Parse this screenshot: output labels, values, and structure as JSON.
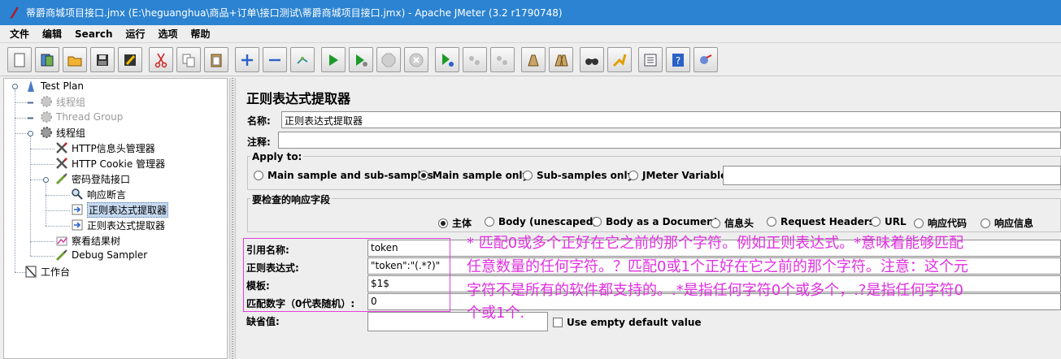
{
  "window": {
    "title": "蒂爵商城项目接口.jmx (E:\\heguanghua\\商品+订单\\接口测试\\蒂爵商城项目接口.jmx) - Apache JMeter (3.2 r1790748)"
  },
  "menu": [
    "文件",
    "编辑",
    "Search",
    "运行",
    "选项",
    "帮助"
  ],
  "toolbar": {
    "buttons": [
      "new-icon",
      "templates-icon",
      "open-icon",
      "save-icon",
      "save-as-icon",
      "cut-icon",
      "copy-icon",
      "paste-icon",
      "expand-icon",
      "collapse-icon",
      "toggle-icon",
      "start-icon",
      "start-no-pause-icon",
      "stop-icon",
      "shutdown-icon",
      "remote-start-icon",
      "remote-stop-icon",
      "remote-shutdown-icon",
      "clear-icon",
      "clear-all-icon",
      "search-icon",
      "reset-search-icon",
      "function-helper-icon",
      "help-icon",
      "log-viewer-icon"
    ]
  },
  "tree": {
    "nodes": [
      {
        "label": "Test Plan",
        "icon": "test-plan-icon"
      },
      {
        "label": "线程组",
        "icon": "gear-icon",
        "disabled": true
      },
      {
        "label": "Thread Group",
        "icon": "gear-icon",
        "disabled": true
      },
      {
        "label": "线程组",
        "icon": "gear-icon"
      },
      {
        "label": "HTTP信息头管理器",
        "icon": "tools-icon"
      },
      {
        "label": "HTTP Cookie 管理器",
        "icon": "tools-icon"
      },
      {
        "label": "密码登陆接口",
        "icon": "pipette-icon"
      },
      {
        "label": "响应断言",
        "icon": "magnifier-icon"
      },
      {
        "label": "正则表达式提取器",
        "icon": "extractor-icon",
        "selected": true
      },
      {
        "label": "正则表达式提取器",
        "icon": "extractor-icon"
      },
      {
        "label": "察看结果树",
        "icon": "chart-icon"
      },
      {
        "label": "Debug Sampler",
        "icon": "pipette-icon"
      },
      {
        "label": "工作台",
        "icon": "workbench-icon"
      }
    ]
  },
  "panel": {
    "title": "正则表达式提取器",
    "name_label": "名称:",
    "name_value": "正则表达式提取器",
    "comment_label": "注释:",
    "comment_value": "",
    "apply_to": {
      "title": "Apply to:",
      "options": [
        "Main sample and sub-samples",
        "Main sample only",
        "Sub-samples only",
        "JMeter Variable"
      ],
      "selected_index": 1,
      "variable_value": ""
    },
    "field_to_check": {
      "title": "要检查的响应字段",
      "options": [
        "主体",
        "Body (unescaped)",
        "Body as a Document",
        "信息头",
        "Request Headers",
        "URL",
        "响应代码",
        "响应信息"
      ],
      "selected_index": 0
    },
    "ref_name_label": "引用名称:",
    "ref_name_value": "token",
    "regex_label": "正则表达式:",
    "regex_value": "\"token\":\"(.*?)\"",
    "template_label": "模板:",
    "template_value": "$1$",
    "match_no_label": "匹配数字（0代表随机）:",
    "match_no_value": "0",
    "default_label": "缺省值:",
    "default_value": "",
    "use_empty_default_label": "Use empty default value"
  },
  "annotation": {
    "lines": [
      "* 匹配0或多个正好在它之前的那个字符。例如正则表达式。*意味着能够匹配",
      "任意数量的任何字符。？匹配0或1个正好在它之前的那个字符。注意：这个元",
      "字符不是所有的软件都支持的。.*是指任何字符0个或多个，.?是指任何字符0",
      "个或1个."
    ],
    "color": "#e030e0"
  },
  "colors": {
    "titlebar": "#2b83d1",
    "selection": "#c5d9f0"
  }
}
